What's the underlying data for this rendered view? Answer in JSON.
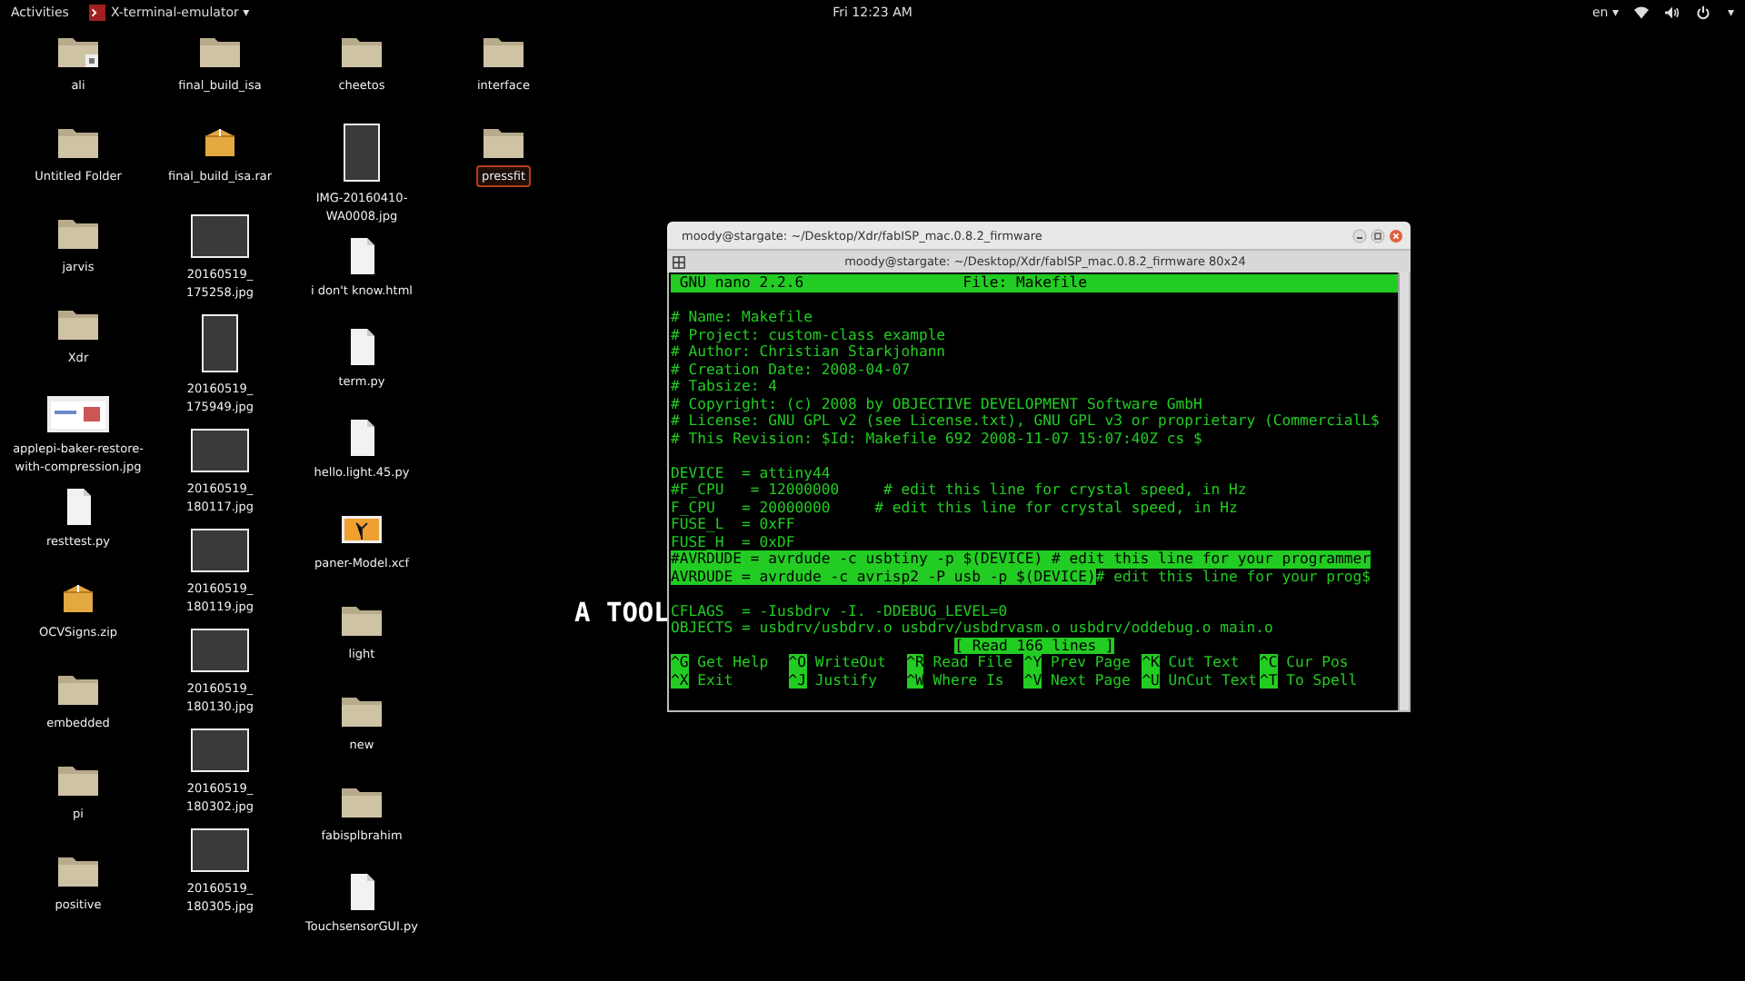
{
  "top_bar": {
    "activities": "Activities",
    "app_menu": "X-terminal-emulator",
    "app_menu_caret": "▾",
    "clock": "Fri 12:23 AM",
    "language": "en",
    "language_caret": "▾",
    "system_caret": "▾"
  },
  "wallpaper": {
    "tagline": "A TOOL"
  },
  "desktop_columns": [
    [
      {
        "label": "ali",
        "kind": "folder-emblem",
        "selected": false
      },
      {
        "label": "Untitled Folder",
        "kind": "folder",
        "selected": false
      },
      {
        "label": "jarvis",
        "kind": "folder",
        "selected": false
      },
      {
        "label": "Xdr",
        "kind": "folder",
        "selected": false
      },
      {
        "label": "applepi-baker-restore-with-compression.jpg",
        "kind": "screenshot",
        "selected": false
      },
      {
        "label": "resttest.py",
        "kind": "document",
        "selected": false
      },
      {
        "label": "OCVSigns.zip",
        "kind": "archive",
        "selected": false
      },
      {
        "label": "embedded",
        "kind": "folder",
        "selected": false
      },
      {
        "label": "pi",
        "kind": "folder",
        "selected": false
      },
      {
        "label": "positive",
        "kind": "folder",
        "selected": false
      }
    ],
    [
      {
        "label": "final_build_isa",
        "kind": "folder",
        "selected": false
      },
      {
        "label": "final_build_isa.rar",
        "kind": "archive",
        "selected": false
      },
      {
        "label": "20160519_ 175258.jpg",
        "kind": "photo",
        "selected": false
      },
      {
        "label": "20160519_ 175949.jpg",
        "kind": "photo-tall",
        "selected": false
      },
      {
        "label": "20160519_ 180117.jpg",
        "kind": "photo",
        "selected": false
      },
      {
        "label": "20160519_ 180119.jpg",
        "kind": "photo",
        "selected": false
      },
      {
        "label": "20160519_ 180130.jpg",
        "kind": "photo",
        "selected": false
      },
      {
        "label": "20160519_ 180302.jpg",
        "kind": "photo",
        "selected": false
      },
      {
        "label": "20160519_ 180305.jpg",
        "kind": "photo",
        "selected": false
      }
    ],
    [
      {
        "label": "cheetos",
        "kind": "folder",
        "selected": false
      },
      {
        "label": "IMG-20160410-WA0008.jpg",
        "kind": "photo-tall",
        "selected": false
      },
      {
        "label": "i don't know.html",
        "kind": "document",
        "selected": false
      },
      {
        "label": "term.py",
        "kind": "document",
        "selected": false
      },
      {
        "label": "hello.light.45.py",
        "kind": "document",
        "selected": false
      },
      {
        "label": "paner-Model.xcf",
        "kind": "image",
        "selected": false
      },
      {
        "label": "light",
        "kind": "folder",
        "selected": false
      },
      {
        "label": "new",
        "kind": "folder",
        "selected": false
      },
      {
        "label": "fabisplbrahim",
        "kind": "folder",
        "selected": false
      },
      {
        "label": "TouchsensorGUI.py",
        "kind": "document",
        "selected": false
      }
    ],
    [
      {
        "label": "interface",
        "kind": "folder",
        "selected": false
      },
      {
        "label": "pressfit",
        "kind": "folder",
        "selected": true
      }
    ]
  ],
  "terminal": {
    "title": "moody@stargate: ~/Desktop/Xdr/fabISP_mac.0.8.2_firmware",
    "tab_title": "moody@stargate: ~/Desktop/Xdr/fabISP_mac.0.8.2_firmware 80x24",
    "header": {
      "left": "GNU nano 2.2.6",
      "center": "File: Makefile"
    },
    "lines": [
      {
        "kind": "blank"
      },
      [
        {
          "text": "# Name: Makefile",
          "highlighted": false
        }
      ],
      [
        {
          "text": "# Project: custom-class example",
          "highlighted": false
        }
      ],
      [
        {
          "text": "# Author: Christian Starkjohann",
          "highlighted": false
        }
      ],
      [
        {
          "text": "# Creation Date: 2008-04-07",
          "highlighted": false
        }
      ],
      [
        {
          "text": "# Tabsize: 4",
          "highlighted": false
        }
      ],
      [
        {
          "text": "# Copyright: (c) 2008 by OBJECTIVE DEVELOPMENT Software GmbH",
          "highlighted": false
        }
      ],
      [
        {
          "text": "# License: GNU GPL v2 (see License.txt), GNU GPL v3 or proprietary (CommercialL$",
          "highlighted": false
        }
      ],
      [
        {
          "text": "# This Revision: $Id: Makefile 692 2008-11-07 15:07:40Z cs $",
          "highlighted": false
        }
      ],
      {
        "kind": "blank"
      },
      [
        {
          "text": "DEVICE  = attiny44",
          "highlighted": false
        }
      ],
      [
        {
          "text": "#F_CPU   = 12000000     # edit this line for crystal speed, in Hz",
          "highlighted": false
        }
      ],
      [
        {
          "text": "F_CPU   = 20000000     # edit this line for crystal speed, in Hz",
          "highlighted": false
        }
      ],
      [
        {
          "text": "FUSE_L  = 0xFF",
          "highlighted": false
        }
      ],
      [
        {
          "text": "FUSE_H  = 0xDF",
          "highlighted": false
        }
      ],
      [
        {
          "text": "#AVRDUDE = avrdude -c usbtiny -p $(DEVICE) # edit this line for your programmer",
          "highlighted": true
        }
      ],
      [
        {
          "text": "AVRDUDE = avrdude -c avrisp2 -P usb -p $(DEVICE)",
          "highlighted": true
        },
        {
          "text": "# edit this line for your prog$",
          "highlighted": false
        }
      ],
      {
        "kind": "blank"
      },
      [
        {
          "text": "CFLAGS  = -Iusbdrv -I. -DDEBUG_LEVEL=0",
          "highlighted": false
        }
      ],
      [
        {
          "text": "OBJECTS = usbdrv/usbdrv.o usbdrv/usbdrvasm.o usbdrv/oddebug.o main.o",
          "highlighted": false
        }
      ]
    ],
    "status": "[ Read 166 lines ]",
    "shortcuts": [
      [
        {
          "key": "^G",
          "label": "Get Help"
        },
        {
          "key": "^O",
          "label": "WriteOut"
        },
        {
          "key": "^R",
          "label": "Read File"
        },
        {
          "key": "^Y",
          "label": "Prev Page"
        },
        {
          "key": "^K",
          "label": "Cut Text"
        },
        {
          "key": "^C",
          "label": "Cur Pos"
        }
      ],
      [
        {
          "key": "^X",
          "label": "Exit"
        },
        {
          "key": "^J",
          "label": "Justify"
        },
        {
          "key": "^W",
          "label": "Where Is"
        },
        {
          "key": "^V",
          "label": "Next Page"
        },
        {
          "key": "^U",
          "label": "UnCut Text"
        },
        {
          "key": "^T",
          "label": "To Spell"
        }
      ]
    ]
  }
}
